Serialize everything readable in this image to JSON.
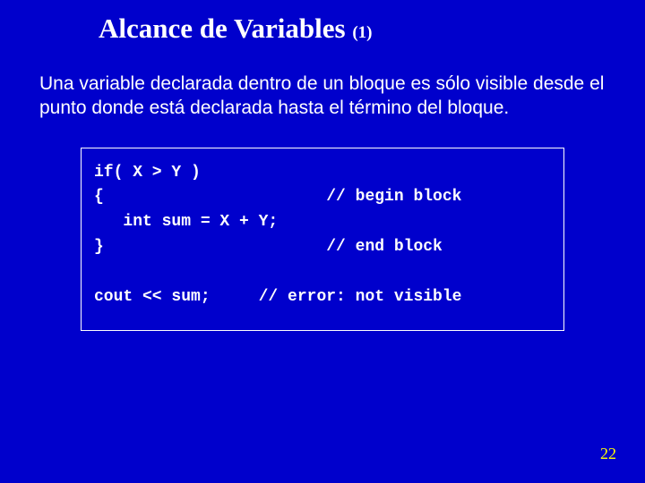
{
  "slide": {
    "title_main": "Alcance de Variables ",
    "title_sub": "(1)",
    "paragraph": "Una variable declarada dentro de un bloque es sólo visible desde el punto donde está declarada hasta el término del bloque.",
    "code_block": "if( X > Y )\n{                       // begin block\n   int sum = X + Y;\n}                       // end block\n\ncout << sum;     // error: not visible",
    "page_number": "22"
  }
}
